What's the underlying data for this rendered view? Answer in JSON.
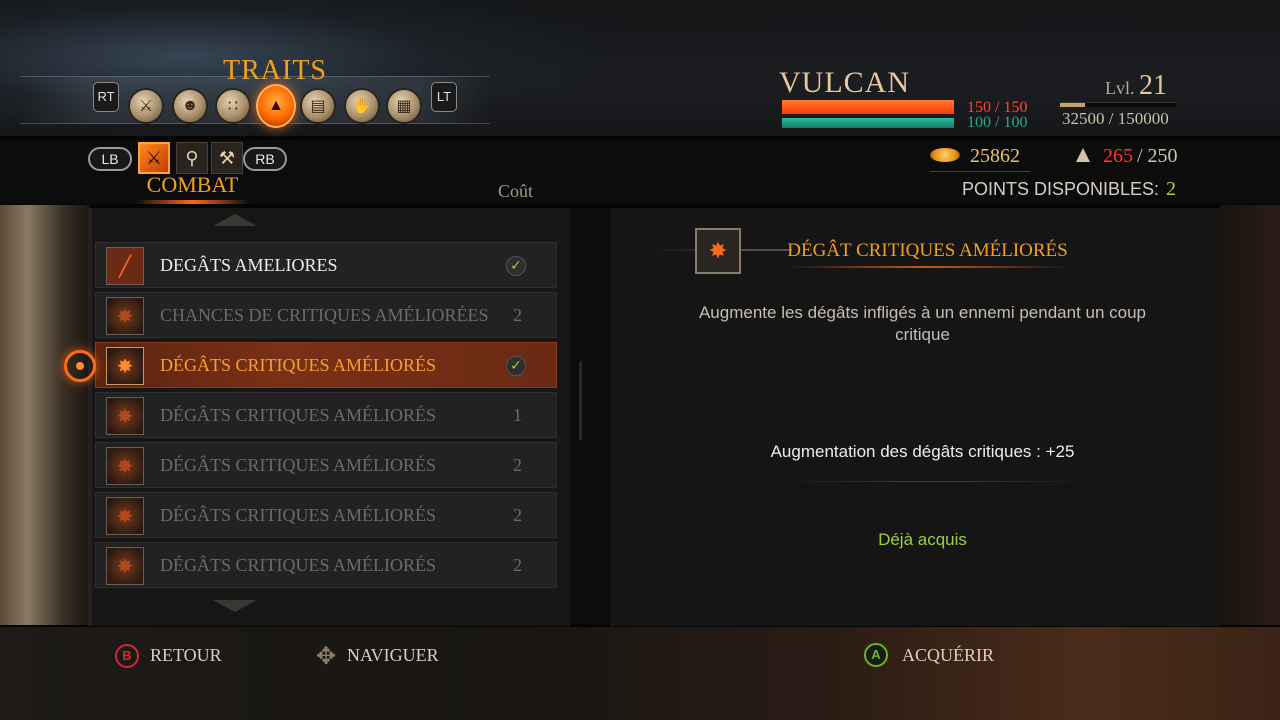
{
  "header": {
    "title": "TRAITS",
    "left_shoulder": "RT",
    "right_shoulder": "LT",
    "categories": [
      {
        "icon": "armor-icon"
      },
      {
        "icon": "head-icon"
      },
      {
        "icon": "orbs-icon"
      },
      {
        "icon": "combat-mask-icon",
        "active": true
      },
      {
        "icon": "scroll-book-icon"
      },
      {
        "icon": "hand-icon"
      },
      {
        "icon": "map-icon"
      }
    ]
  },
  "character": {
    "name": "VULCAN",
    "hp_text": "150 / 150",
    "stamina_text": "100 / 100",
    "level_label": "Lvl.",
    "level": "21",
    "xp_text": "32500 / 150000",
    "xp_fraction": 0.2167,
    "colors": {
      "hp": "#ff4a00",
      "stamina": "#2aaa8a"
    }
  },
  "subheader": {
    "left_bumper": "LB",
    "right_bumper": "RB",
    "subcategories": [
      {
        "icon": "crossed-swords-icon",
        "active": true
      },
      {
        "icon": "magnifier-icon"
      },
      {
        "icon": "hammer-icon"
      }
    ],
    "active_label": "COMBAT",
    "cost_header": "Coût",
    "gold": "25862",
    "weight_current": "265",
    "weight_max": "/ 250",
    "points_label": "POINTS DISPONIBLES:",
    "points_value": "2"
  },
  "traits": [
    {
      "label": "DEGÂTS AMELIORES",
      "status": "acquired",
      "cost": ""
    },
    {
      "label": "CHANCES DE CRITIQUES AMÉLIORÉES",
      "status": "locked",
      "cost": "2"
    },
    {
      "label": "DÉGÂTS CRITIQUES AMÉLIORÉS",
      "status": "acquired",
      "cost": "",
      "selected": true
    },
    {
      "label": "DÉGÂTS CRITIQUES AMÉLIORÉS",
      "status": "locked",
      "cost": "1"
    },
    {
      "label": "DÉGÂTS CRITIQUES AMÉLIORÉS",
      "status": "locked",
      "cost": "2"
    },
    {
      "label": "DÉGÂTS CRITIQUES AMÉLIORÉS",
      "status": "locked",
      "cost": "2"
    },
    {
      "label": "DÉGÂTS CRITIQUES AMÉLIORÉS",
      "status": "locked",
      "cost": "2"
    }
  ],
  "detail": {
    "title": "DÉGÂT CRITIQUES AMÉLIORÉS",
    "description": "Augmente les dégâts infligés à un ennemi pendant un coup critique",
    "stat": "Augmentation des dégâts critiques : +25",
    "status": "Déjà acquis"
  },
  "footer": {
    "back_button": "B",
    "back_label": "RETOUR",
    "navigate_label": "NAVIGUER",
    "acquire_button": "A",
    "acquire_label": "ACQUÉRIR"
  }
}
